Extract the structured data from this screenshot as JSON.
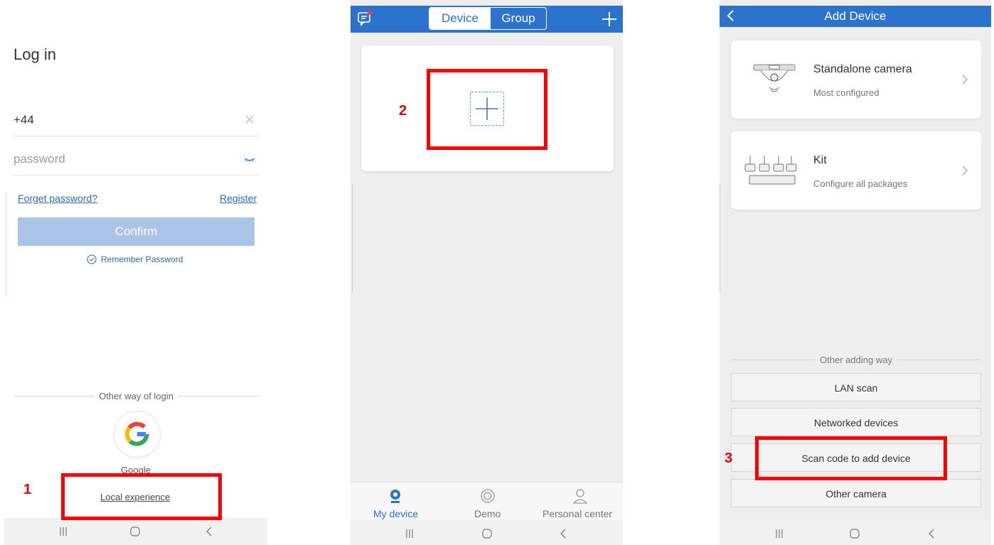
{
  "login": {
    "title": "Log in",
    "phone_value": "+44",
    "password_placeholder": "password",
    "forget_label": "Forget password?",
    "register_label": "Register",
    "confirm_label": "Confirm",
    "remember_label": "Remember Password",
    "other_login_label": "Other way of login",
    "google_label": "Google",
    "local_experience_label": "Local experience"
  },
  "devices": {
    "tab_device": "Device",
    "tab_group": "Group",
    "bottom_tabs": [
      "My device",
      "Demo",
      "Personal center"
    ]
  },
  "add_device": {
    "title": "Add Device",
    "cards": [
      {
        "name": "Standalone camera",
        "sub": "Most configured"
      },
      {
        "name": "Kit",
        "sub": "Configure all packages"
      }
    ],
    "other_way_label": "Other adding way",
    "options": [
      "LAN scan",
      "Networked devices",
      "Scan code to add device",
      "Other camera"
    ]
  },
  "annotations": [
    "1",
    "2",
    "3"
  ],
  "colors": {
    "brand_blue": "#2b73cc",
    "confirm_disabled": "#a9c4e6",
    "annotation_red": "#ff0000"
  }
}
